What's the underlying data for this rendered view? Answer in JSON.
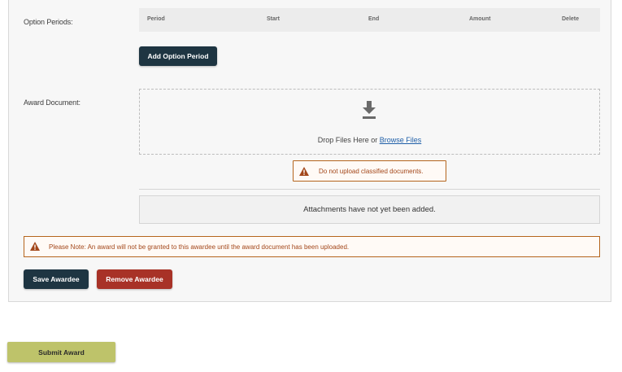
{
  "option_periods": {
    "label": "Option Periods:",
    "columns": [
      "Period",
      "Start",
      "End",
      "Amount",
      "Delete"
    ],
    "add_button": "Add Option Period"
  },
  "award_document": {
    "label": "Award Document:",
    "drop_text": "Drop Files Here or ",
    "browse_link": "Browse Files",
    "warning": "Do not upload classified documents.",
    "attachments_status": "Attachments have not yet been added."
  },
  "notice": "Please Note: An award will not be granted to this awardee until the award document has been uploaded.",
  "actions": {
    "save": "Save Awardee",
    "remove": "Remove Awardee",
    "submit": "Submit Award"
  },
  "colors": {
    "primary_dark": "#1e3542",
    "danger": "#a83227",
    "warning": "#b5651d",
    "submit": "#bec36a"
  },
  "icons": {
    "download": "download-icon",
    "warning": "warning-icon"
  }
}
